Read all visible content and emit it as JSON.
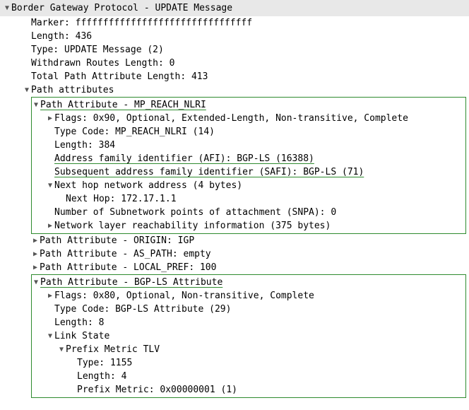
{
  "header": {
    "title": "Border Gateway Protocol - UPDATE Message"
  },
  "fields": {
    "marker": "Marker: ffffffffffffffffffffffffffffffff",
    "length": "Length: 436",
    "type": "Type: UPDATE Message (2)",
    "withdrawn_routes_length": "Withdrawn Routes Length: 0",
    "total_path_attr_length": "Total Path Attribute Length: 413",
    "path_attributes_label": "Path attributes"
  },
  "pa1": {
    "title": "Path Attribute - MP_REACH_NLRI",
    "flags": "Flags: 0x90, Optional, Extended-Length, Non-transitive, Complete",
    "type_code": "Type Code: MP_REACH_NLRI (14)",
    "length": "Length: 384",
    "afi": "Address family identifier (AFI): BGP-LS (16388)",
    "safi": "Subsequent address family identifier (SAFI): BGP-LS (71)",
    "next_hop_header": "Next hop network address (4 bytes)",
    "next_hop": "Next Hop: 172.17.1.1",
    "snpa": "Number of Subnetwork points of attachment (SNPA): 0",
    "nlri": "Network layer reachability information (375 bytes)"
  },
  "pa2": {
    "title": "Path Attribute - ORIGIN: IGP"
  },
  "pa3": {
    "title": "Path Attribute - AS_PATH: empty"
  },
  "pa4": {
    "title": "Path Attribute - LOCAL_PREF: 100"
  },
  "pa5": {
    "title": "Path Attribute - BGP-LS Attribute",
    "flags": "Flags: 0x80, Optional, Non-transitive, Complete",
    "type_code": "Type Code: BGP-LS Attribute (29)",
    "length": "Length: 8",
    "link_state_label": "Link State",
    "tlv_label": "Prefix Metric TLV",
    "tlv_type": "Type: 1155",
    "tlv_length": "Length: 4",
    "tlv_metric": "Prefix Metric: 0x00000001 (1)"
  }
}
